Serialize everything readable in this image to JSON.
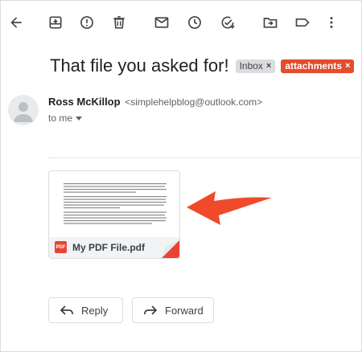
{
  "toolbar": {
    "icons": [
      "back-arrow-icon",
      "archive-icon",
      "report-spam-icon",
      "delete-icon",
      "mark-unread-icon",
      "snooze-icon",
      "add-to-tasks-icon",
      "move-to-icon",
      "label-icon",
      "more-options-icon"
    ]
  },
  "subject": "That file you asked for!",
  "labels": [
    {
      "text": "Inbox",
      "remove": "×"
    },
    {
      "text": "attachments",
      "remove": "×",
      "color": "#e34c2c"
    }
  ],
  "sender": {
    "name": "Ross McKillop",
    "email": "<simplehelpblog@outlook.com>"
  },
  "recipient": "to me",
  "attachment": {
    "filename": "My PDF File.pdf",
    "type_label": "PDF"
  },
  "annotation": {
    "arrow_color": "#f04a2b"
  },
  "actions": {
    "reply": "Reply",
    "forward": "Forward"
  }
}
